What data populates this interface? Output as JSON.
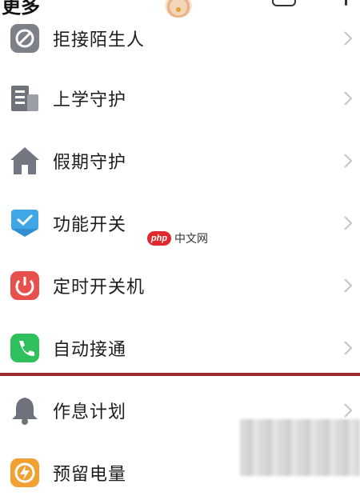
{
  "header": {
    "title": "更多"
  },
  "menu": {
    "items": [
      {
        "label": "拒接陌生人",
        "icon": "block-stranger-icon"
      },
      {
        "label": "上学守护",
        "icon": "school-building-icon"
      },
      {
        "label": "假期守护",
        "icon": "home-icon"
      },
      {
        "label": "功能开关",
        "icon": "function-switch-icon"
      },
      {
        "label": "定时开关机",
        "icon": "power-icon"
      },
      {
        "label": "自动接通",
        "icon": "phone-icon"
      },
      {
        "label": "作息计划",
        "icon": "bell-icon"
      },
      {
        "label": "预留电量",
        "icon": "battery-charge-icon"
      }
    ]
  },
  "watermark": {
    "badge": "php",
    "text": "中文网"
  },
  "colors": {
    "highlight_border": "#9b2a2c",
    "background": "#ffffff"
  }
}
